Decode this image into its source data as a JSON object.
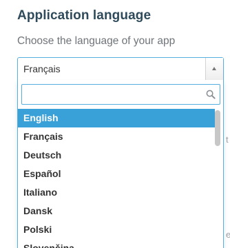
{
  "section": {
    "title": "Application language",
    "subtitle": "Choose the language of your app"
  },
  "select": {
    "value": "Français",
    "arrow_icon": "chevron-up-icon"
  },
  "dropdown": {
    "search": {
      "value": "",
      "placeholder": "",
      "icon": "search-icon"
    },
    "options": [
      {
        "label": "English",
        "selected": true
      },
      {
        "label": "Français",
        "selected": false
      },
      {
        "label": "Deutsch",
        "selected": false
      },
      {
        "label": "Español",
        "selected": false
      },
      {
        "label": "Italiano",
        "selected": false
      },
      {
        "label": "Dansk",
        "selected": false
      },
      {
        "label": "Polski",
        "selected": false
      },
      {
        "label": "Slovenčina",
        "selected": false
      }
    ]
  },
  "background": {
    "fragment_1": "t",
    "fragment_2": "es"
  },
  "colors": {
    "title": "#2f4a5a",
    "accent_border": "#55aee0",
    "selected_bg": "#3aa0d8"
  }
}
